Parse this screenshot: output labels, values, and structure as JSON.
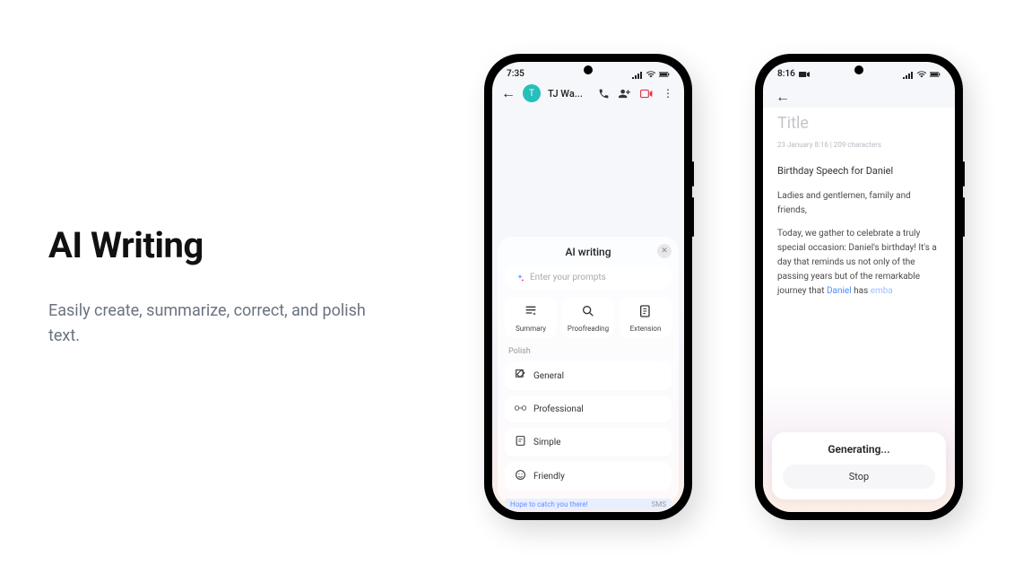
{
  "hero": {
    "heading": "AI Writing",
    "subhead": "Easily create, summarize, correct, and polish text."
  },
  "phone1": {
    "time": "7:35",
    "contact_initial": "T",
    "contact_name": "TJ Wa...",
    "panel_title": "AI writing",
    "prompt_placeholder": "Enter your prompts",
    "actions": [
      {
        "label": "Summary"
      },
      {
        "label": "Proofreading"
      },
      {
        "label": "Extension"
      }
    ],
    "polish_section": "Polish",
    "polish_items": [
      {
        "label": "General"
      },
      {
        "label": "Professional"
      },
      {
        "label": "Simple"
      },
      {
        "label": "Friendly"
      }
    ],
    "snippet": "Hope to catch you there!",
    "snippet_badge": "SMS"
  },
  "phone2": {
    "time": "8:16",
    "title_placeholder": "Title",
    "meta": "23 January 8:16  |  209 characters",
    "doc_heading": "Birthday Speech for Daniel",
    "para1": "Ladies and gentlemen, family and friends,",
    "para2_a": "Today, we gather to celebrate a truly special occasion: Daniel's birthday! It's a day that reminds us not only of the passing years but of the remarkable journey that ",
    "para2_hl1": "Daniel",
    "para2_b": " has ",
    "para2_hl2": "emba",
    "gen_status": "Generating...",
    "stop_label": "Stop"
  }
}
